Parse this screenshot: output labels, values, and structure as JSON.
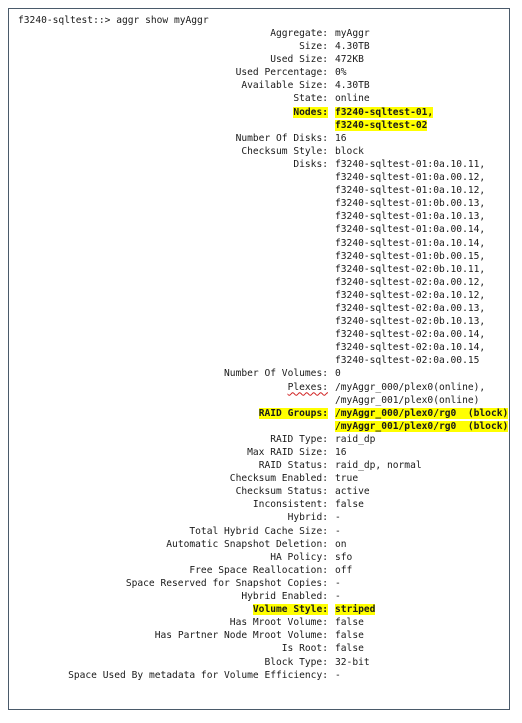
{
  "prompt": "f3240-sqltest::> aggr show myAggr",
  "rows": [
    {
      "label": "Aggregate:",
      "value": "myAggr"
    },
    {
      "label": "Size:",
      "value": "4.30TB"
    },
    {
      "label": "Used Size:",
      "value": "472KB"
    },
    {
      "label": "Used Percentage:",
      "value": "0%"
    },
    {
      "label": "Available Size:",
      "value": "4.30TB"
    },
    {
      "label": "State:",
      "value": "online"
    },
    {
      "label": "Nodes:",
      "value": "f3240-sqltest-01,",
      "highlight": true
    },
    {
      "label": "",
      "value": "f3240-sqltest-02",
      "highlight": true
    },
    {
      "label": "Number Of Disks:",
      "value": "16"
    },
    {
      "label": "Checksum Style:",
      "value": "block"
    },
    {
      "label": "Disks:",
      "value": "f3240-sqltest-01:0a.10.11,"
    },
    {
      "label": "",
      "value": "f3240-sqltest-01:0a.00.12,"
    },
    {
      "label": "",
      "value": "f3240-sqltest-01:0a.10.12,"
    },
    {
      "label": "",
      "value": "f3240-sqltest-01:0b.00.13,"
    },
    {
      "label": "",
      "value": "f3240-sqltest-01:0a.10.13,"
    },
    {
      "label": "",
      "value": "f3240-sqltest-01:0a.00.14,"
    },
    {
      "label": "",
      "value": "f3240-sqltest-01:0a.10.14,"
    },
    {
      "label": "",
      "value": "f3240-sqltest-01:0b.00.15,"
    },
    {
      "label": "",
      "value": "f3240-sqltest-02:0b.10.11,"
    },
    {
      "label": "",
      "value": "f3240-sqltest-02:0a.00.12,"
    },
    {
      "label": "",
      "value": "f3240-sqltest-02:0a.10.12,"
    },
    {
      "label": "",
      "value": "f3240-sqltest-02:0a.00.13,"
    },
    {
      "label": "",
      "value": "f3240-sqltest-02:0b.10.13,"
    },
    {
      "label": "",
      "value": "f3240-sqltest-02:0a.00.14,"
    },
    {
      "label": "",
      "value": "f3240-sqltest-02:0a.10.14,"
    },
    {
      "label": "",
      "value": "f3240-sqltest-02:0a.00.15"
    },
    {
      "label": "Number Of Volumes:",
      "value": "0"
    },
    {
      "label": "Plexes:",
      "value": "/myAggr_000/plex0(online),",
      "label_squiggle": true
    },
    {
      "label": "",
      "value": "/myAggr_001/plex0(online)"
    },
    {
      "label": "RAID Groups:",
      "value": "/myAggr_000/plex0/rg0  (block)",
      "highlight": true
    },
    {
      "label": "",
      "value": "/myAggr_001/plex0/rg0  (block)",
      "highlight": true
    },
    {
      "label": "RAID Type:",
      "value": "raid_dp"
    },
    {
      "label": "Max RAID Size:",
      "value": "16"
    },
    {
      "label": "RAID Status:",
      "value": "raid_dp, normal"
    },
    {
      "label": "Checksum Enabled:",
      "value": "true"
    },
    {
      "label": "Checksum Status:",
      "value": "active"
    },
    {
      "label": "Inconsistent:",
      "value": "false"
    },
    {
      "label": "Hybrid:",
      "value": "-"
    },
    {
      "label": "Total Hybrid Cache Size:",
      "value": "-"
    },
    {
      "label": "Automatic Snapshot Deletion:",
      "value": "on"
    },
    {
      "label": "HA Policy:",
      "value": "sfo"
    },
    {
      "label": "Free Space Reallocation:",
      "value": "off"
    },
    {
      "label": "Space Reserved for Snapshot Copies:",
      "value": "-"
    },
    {
      "label": "Hybrid Enabled:",
      "value": "-"
    },
    {
      "label": "Volume Style:",
      "value": "striped",
      "highlight": true
    },
    {
      "label": "Has Mroot Volume:",
      "value": "false"
    },
    {
      "label": "Has Partner Node Mroot Volume:",
      "value": "false"
    },
    {
      "label": "Is Root:",
      "value": "false"
    },
    {
      "label": "Block Type:",
      "value": "32-bit"
    },
    {
      "label": "Space Used By metadata for Volume Efficiency:",
      "value": "-"
    }
  ],
  "colors": {
    "highlight": "#ffff00",
    "frame_border": "#4a5a6a"
  }
}
